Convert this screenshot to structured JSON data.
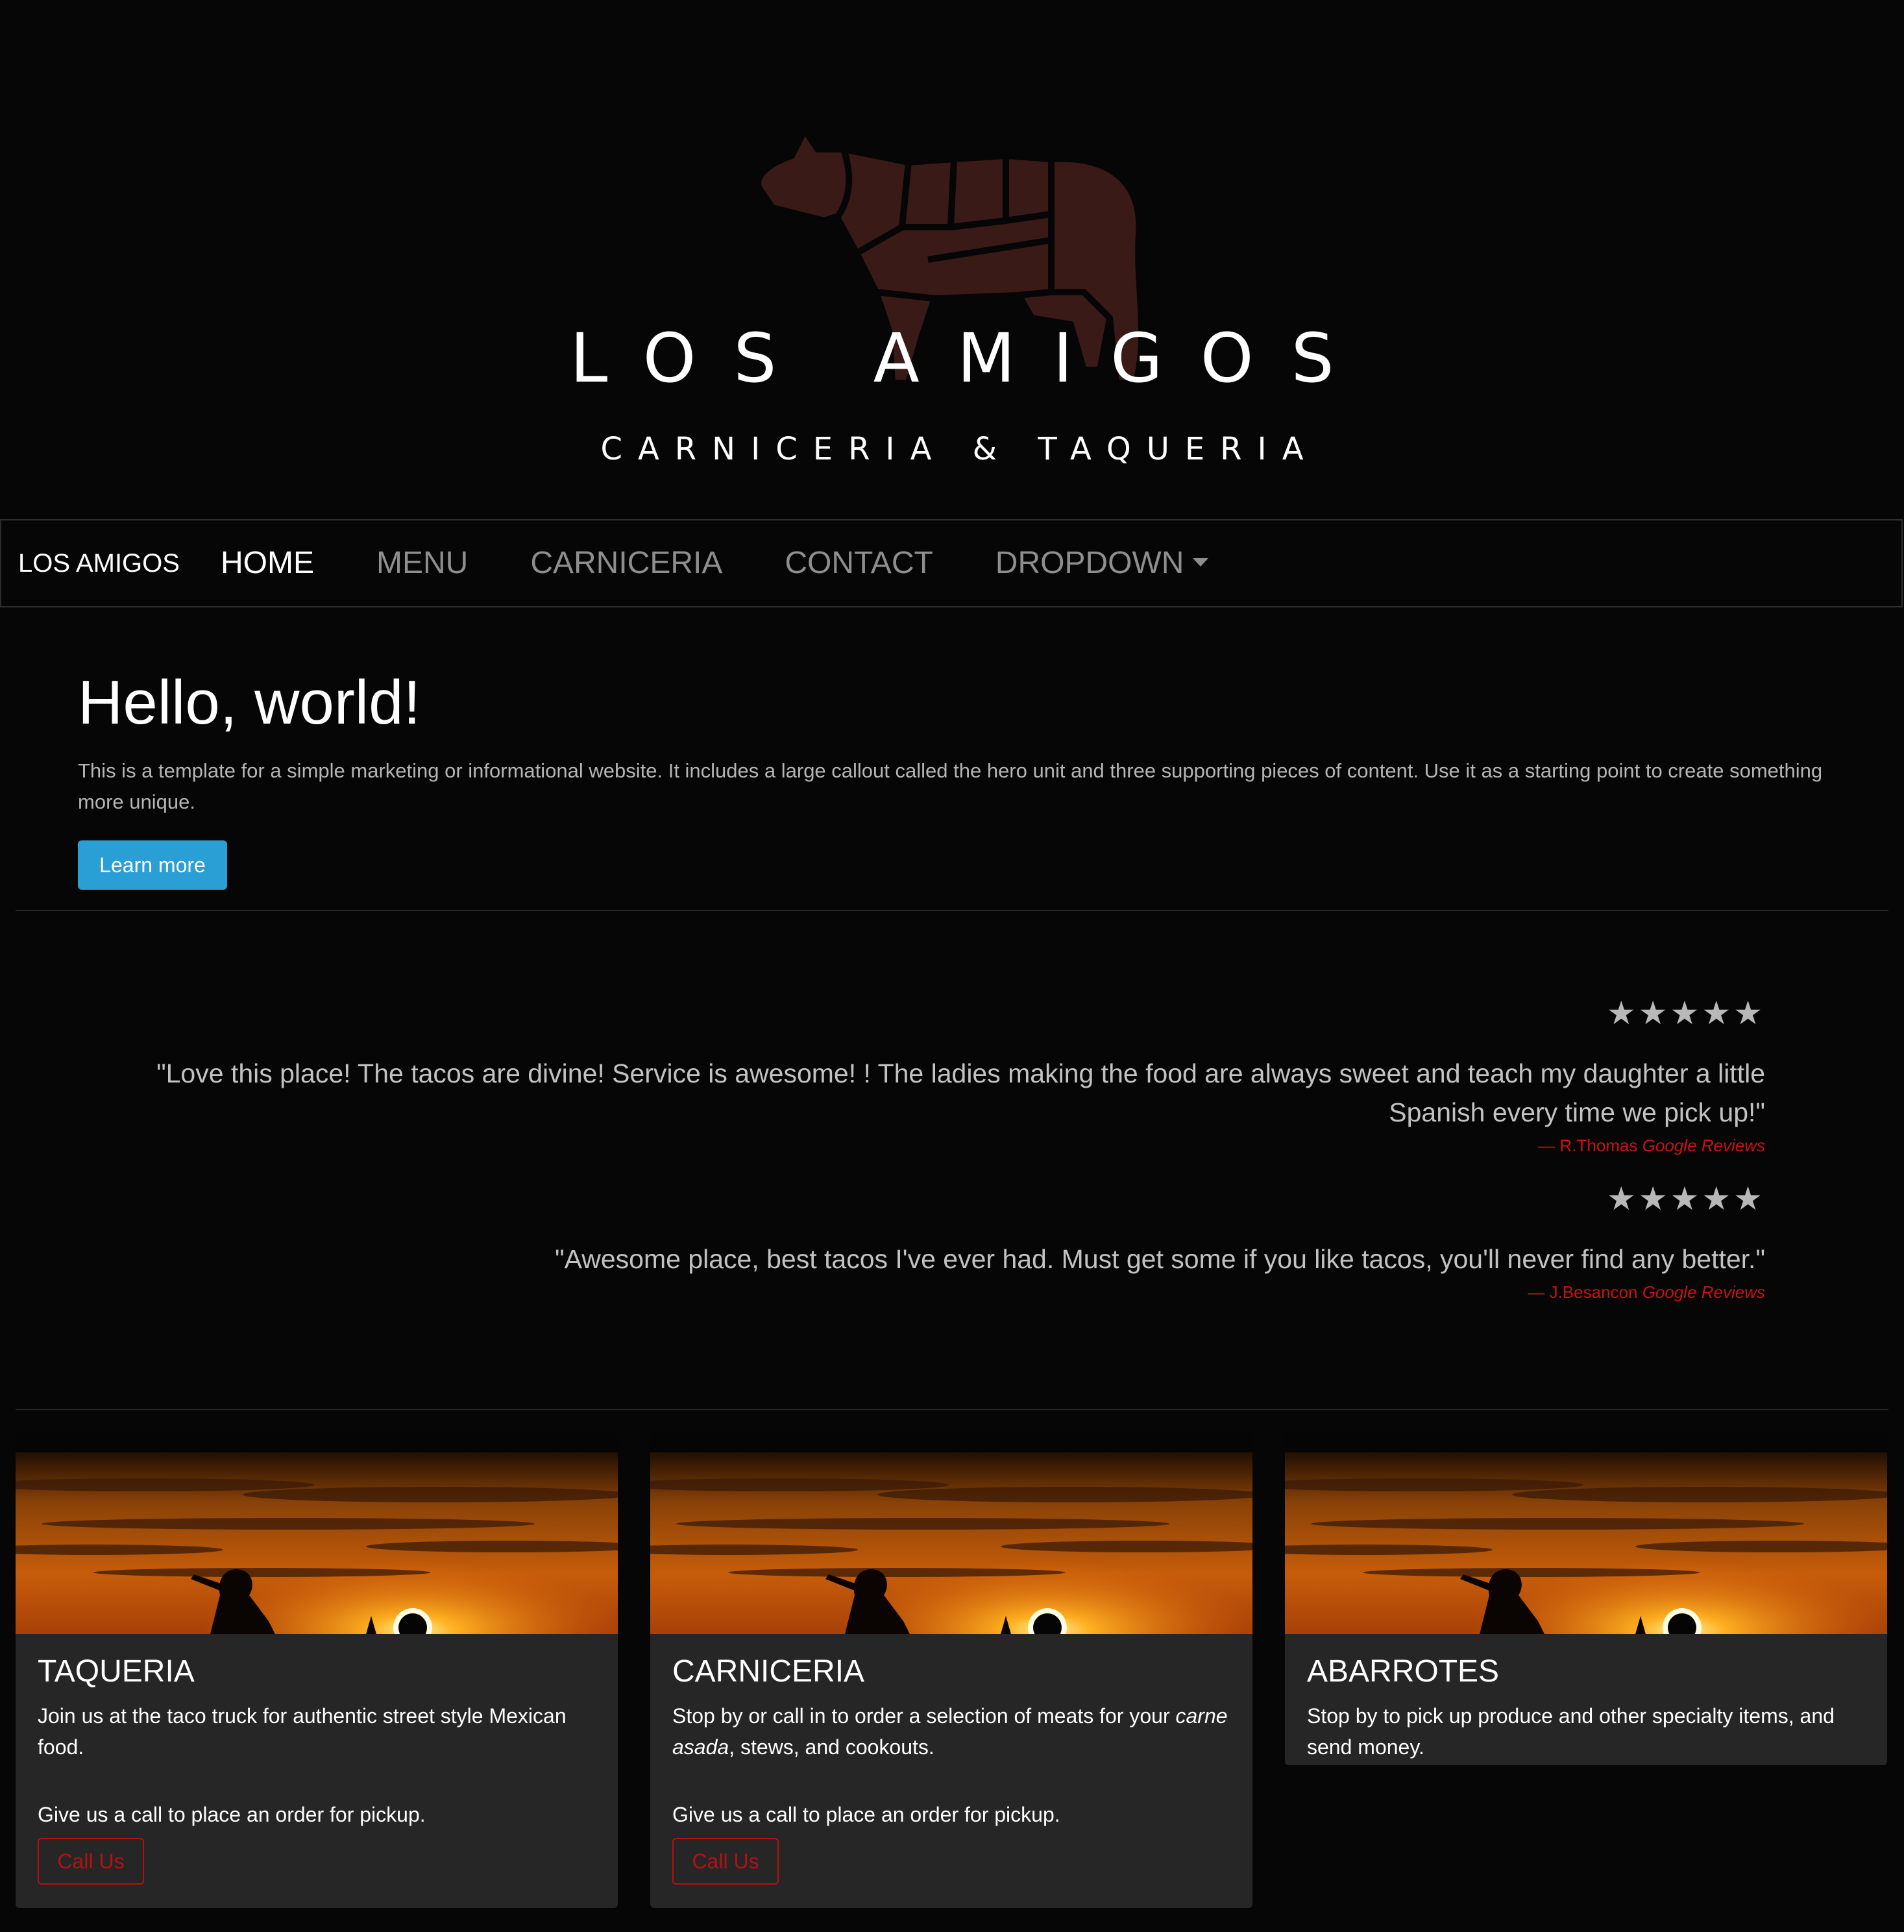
{
  "header": {
    "brand_title": "LOS AMIGOS",
    "brand_subtitle": "CARNICERIA & TAQUERIA",
    "logo_icon": "cow-butcher-cuts-icon",
    "logo_color": "#3a1a17"
  },
  "navbar": {
    "brand": "LOS AMIGOS",
    "items": [
      {
        "label": "HOME",
        "active": true
      },
      {
        "label": "MENU",
        "active": false
      },
      {
        "label": "CARNICERIA",
        "active": false
      },
      {
        "label": "CONTACT",
        "active": false
      },
      {
        "label": "DROPDOWN",
        "active": false,
        "has_caret": true
      }
    ]
  },
  "hero": {
    "title": "Hello, world!",
    "text": "This is a template for a simple marketing or informational website. It includes a large callout called the hero unit and three supporting pieces of content. Use it as a starting point to create something more unique.",
    "button_label": "Learn more",
    "button_color": "#2a9fd6"
  },
  "reviews": [
    {
      "stars": "★★★★★",
      "rating": 5,
      "quote": "\"Love this place! The tacos are divine! Service is awesome! ! The ladies making the food are always sweet and teach my daughter a little Spanish every time we pick up!\"",
      "author": "R.Thomas",
      "source": "Google Reviews"
    },
    {
      "stars": "★★★★★",
      "rating": 5,
      "quote": "\"Awesome place, best tacos I've ever had. Must get some if you like tacos, you'll never find any better.\"",
      "author": "J.Besancon",
      "source": "Google Reviews"
    }
  ],
  "cards": [
    {
      "title": "TAQUERIA",
      "text": "Join us at the taco truck for authentic street style Mexican food.",
      "text2": "Give us a call to place an order for pickup.",
      "button_label": "Call Us"
    },
    {
      "title": "CARNICERIA",
      "text_before": "Stop by or call in to order a selection of meats for your ",
      "text_italic": "carne asada",
      "text_after": ", stews, and cookouts.",
      "text2": "Give us a call to place an order for pickup.",
      "button_label": "Call Us"
    },
    {
      "title": "ABARROTES",
      "text": "Stop by to pick up produce and other specialty items, and send money."
    }
  ],
  "colors": {
    "background": "#060606",
    "card_bg": "#262626",
    "accent_red": "#b51111",
    "nav_inactive": "#8e8e8e"
  }
}
